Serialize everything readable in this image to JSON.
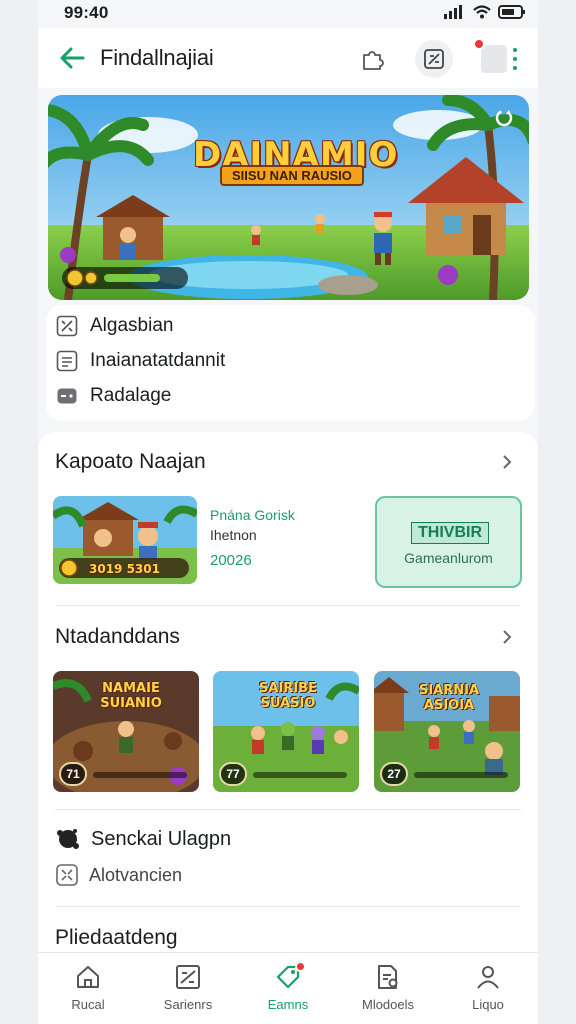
{
  "status_bar": {
    "time": "99:40"
  },
  "app_bar": {
    "title": "Findallnajiai"
  },
  "hero": {
    "logo": "DAINAMIO",
    "subtitle": "SIISU NAN RAUSIO"
  },
  "info": {
    "rows": [
      {
        "icon": "tools-icon",
        "label": "Algasbian"
      },
      {
        "icon": "document-icon",
        "label": "Inaianatatdannit"
      },
      {
        "icon": "gamepad-icon",
        "label": "Radalage"
      }
    ]
  },
  "featured": {
    "title": "Kapoato Naajan",
    "thumb_label": "3019 5301",
    "meta_line1": "Pnána Gorisk",
    "meta_line2": "Ihetnon",
    "meta_line3": "20026",
    "promo_title": "THIVBIR",
    "promo_sub": "Gameanlurom"
  },
  "more": {
    "title": "Ntadanddans",
    "cards": [
      {
        "title": "NAMAIE SUIANIO",
        "score": "71"
      },
      {
        "title": "SAIRIBE SUASIO",
        "score": "77"
      },
      {
        "title": "SIARNIA ASIOIA",
        "score": "27"
      }
    ]
  },
  "community": {
    "row1": "Senckai Ulagpn",
    "row2": "Alotvancien"
  },
  "bottom_section": {
    "title": "Pliedaatdeng"
  },
  "nav": [
    {
      "label": "Rucal",
      "active": false
    },
    {
      "label": "Sarienrs",
      "active": false
    },
    {
      "label": "Eamns",
      "active": true
    },
    {
      "label": "Mlodoels",
      "active": false
    },
    {
      "label": "Liquo",
      "active": false
    }
  ],
  "colors": {
    "accent": "#17a06a",
    "badge": "#e53935"
  }
}
